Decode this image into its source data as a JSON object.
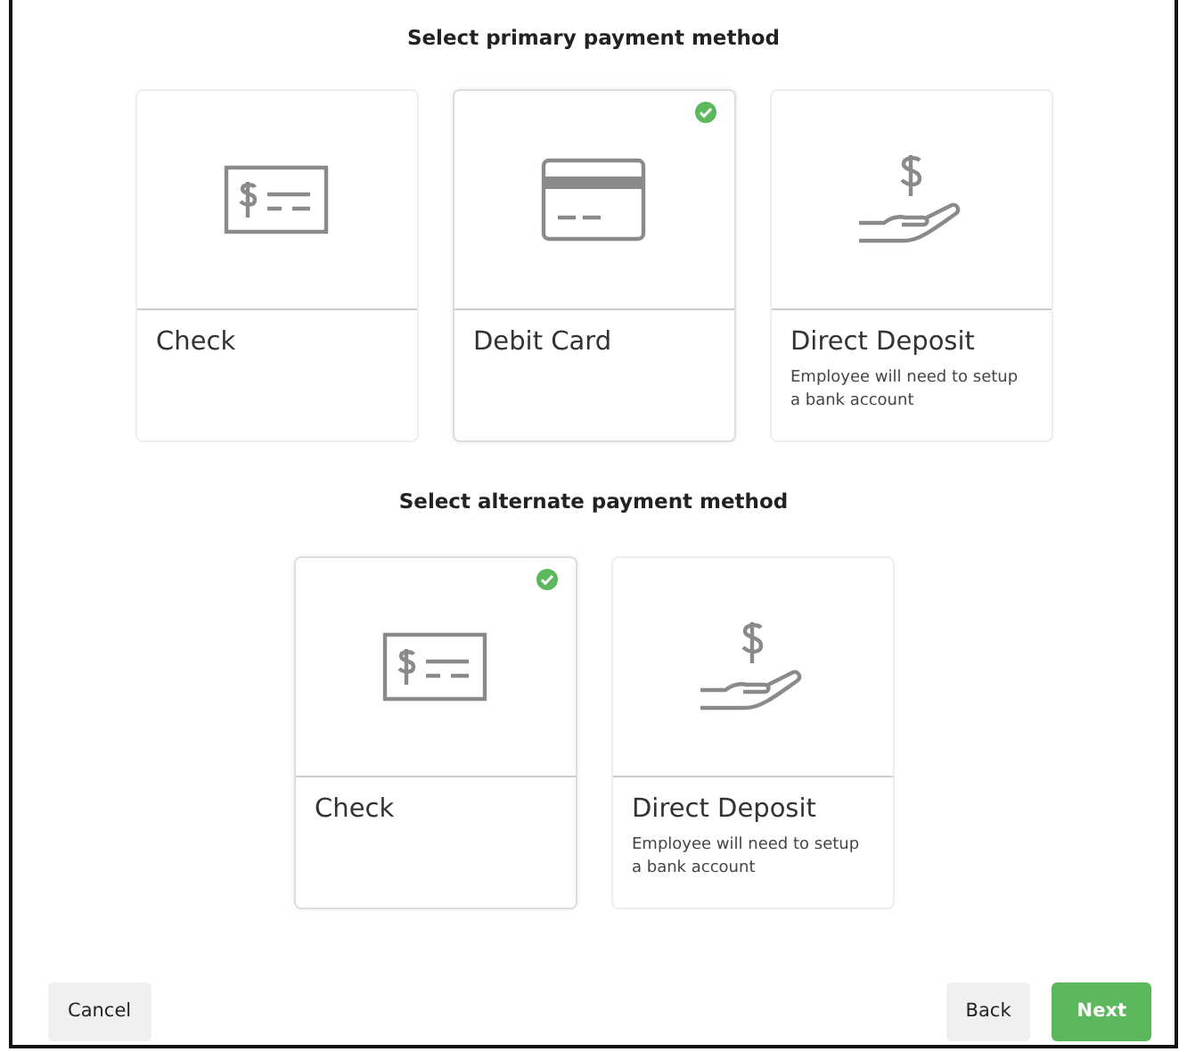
{
  "sections": [
    {
      "heading": "Select primary payment method",
      "options": [
        {
          "kind": "check",
          "label": "Check",
          "selected": false
        },
        {
          "kind": "card",
          "label": "Debit Card",
          "selected": true
        },
        {
          "kind": "deposit",
          "label": "Direct Deposit",
          "description": "Employee will need to setup a bank account",
          "selected": false
        }
      ]
    },
    {
      "heading": "Select alternate payment method",
      "options": [
        {
          "kind": "check",
          "label": "Check",
          "selected": true
        },
        {
          "kind": "deposit",
          "label": "Direct Deposit",
          "description": "Employee will need to setup a bank account",
          "selected": false
        }
      ]
    }
  ],
  "buttons": [
    {
      "kind": "secondary",
      "label": "Cancel"
    },
    {
      "kind": "secondary",
      "label": "Back"
    },
    {
      "kind": "primary",
      "label": "Next"
    }
  ]
}
